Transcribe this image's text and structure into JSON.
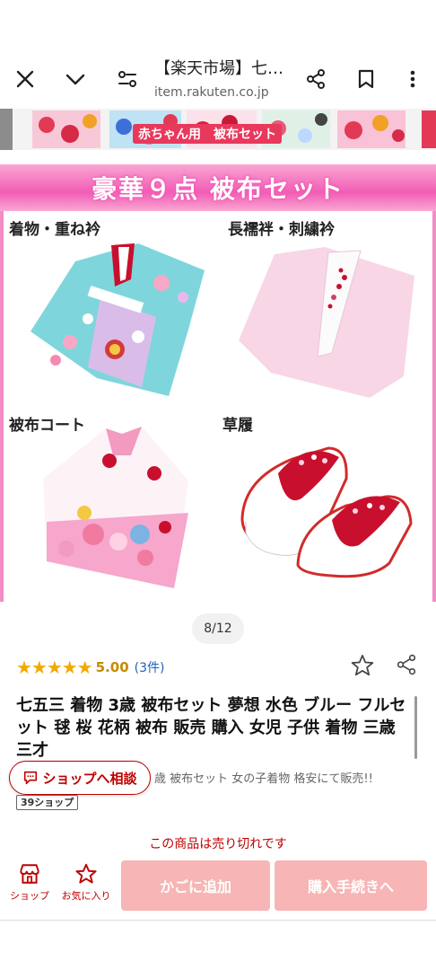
{
  "browser": {
    "title": "【楽天市場】七…",
    "url": "item.rakuten.co.jp"
  },
  "thumbnails": {
    "caption": "赤ちゃん用　被布セット"
  },
  "product_image": {
    "banner": "豪華９点 被布セット",
    "items": [
      {
        "label": "着物・重ね衿"
      },
      {
        "label": "長襦袢・刺繍衿"
      },
      {
        "label": "被布コート"
      },
      {
        "label": "草履"
      }
    ]
  },
  "pager": {
    "text": "8/12"
  },
  "rating": {
    "stars": "★★★★★",
    "score": "5.00",
    "count": "(3件)"
  },
  "product": {
    "title": "七五三 着物 3歳 被布セット 夢想 水色 ブルー フルセット 毬 桜 花柄 被布 販売 購入 女児 子供 着物 三歳 三才",
    "subtitle": "歳 被布セット 女の子着物 格安にて販売!!",
    "shop_badge": "39ショップ",
    "shop_button": "ショップへ相談",
    "soldout": "この商品は売り切れです"
  },
  "bottom_bar": {
    "shop_label": "ショップ",
    "fav_label": "お気に入り",
    "cart_label": "かごに追加",
    "buy_label": "購入手続きへ"
  },
  "colors": {
    "accent": "#bf0000",
    "disabled_button": "#f7b5b5",
    "banner": "#f25db5",
    "star": "#f2a900"
  }
}
